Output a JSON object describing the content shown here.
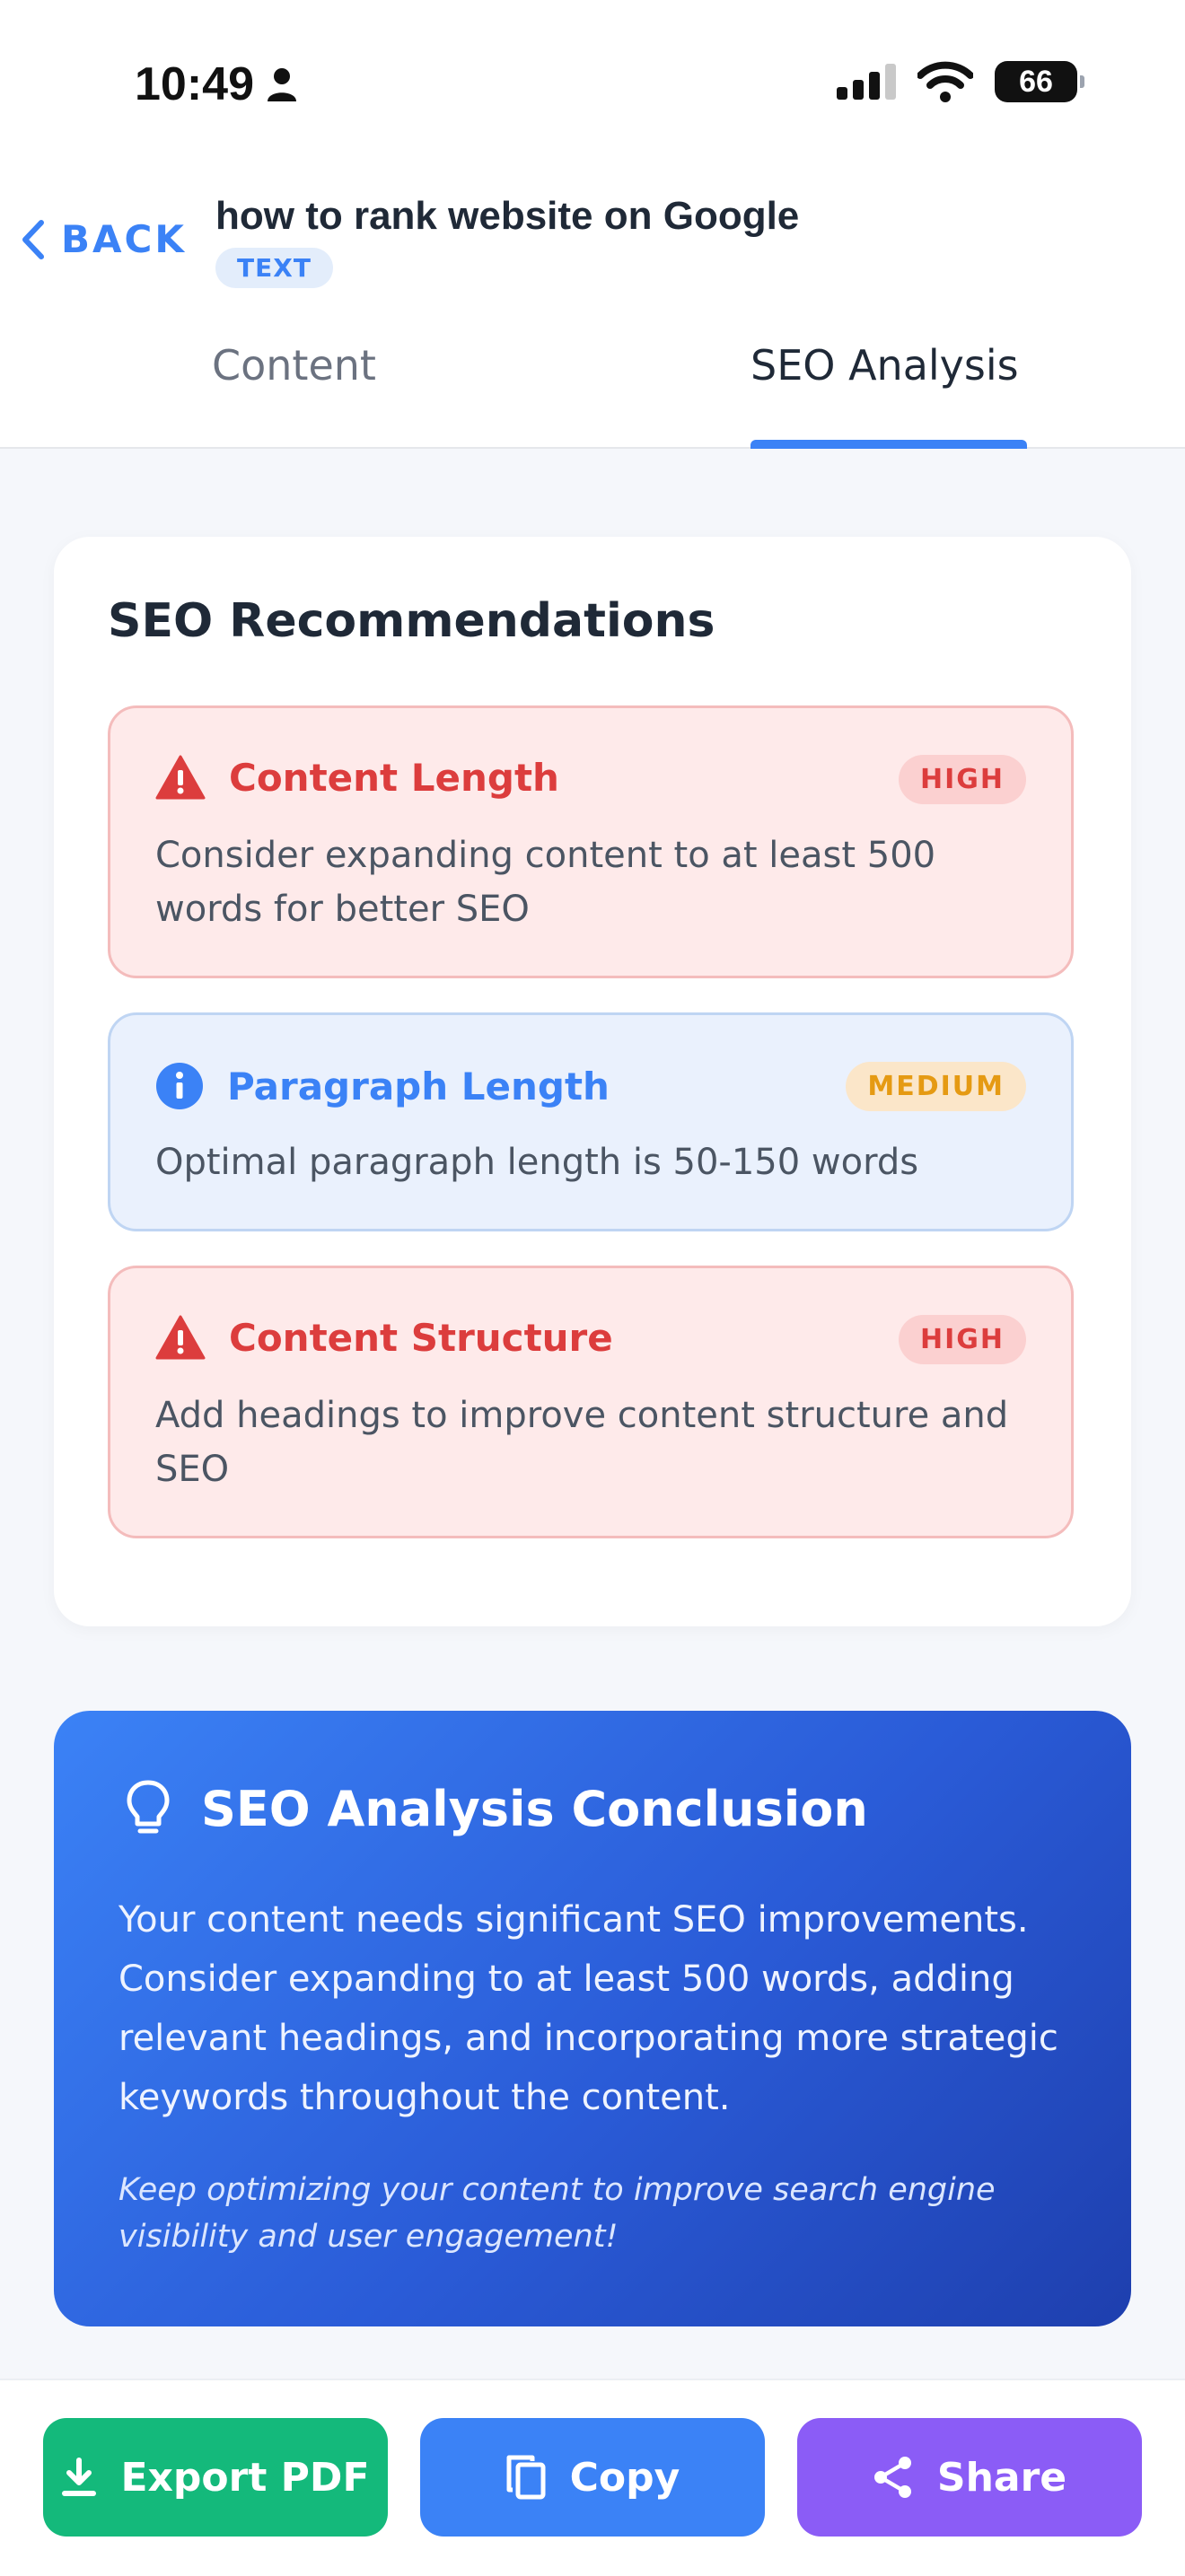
{
  "status": {
    "time": "10:49",
    "battery": "66"
  },
  "header": {
    "back_label": "BACK",
    "title": "how to rank website on Google",
    "type_badge": "TEXT"
  },
  "tabs": [
    {
      "label": "Content"
    },
    {
      "label": "SEO Analysis",
      "active": true
    }
  ],
  "recommendations": {
    "title": "SEO Recommendations",
    "items": [
      {
        "icon": "warning-icon",
        "label": "Content Length",
        "priority": "HIGH",
        "description": "Consider expanding content to at least 500 words for better SEO"
      },
      {
        "icon": "info-icon",
        "label": "Paragraph Length",
        "priority": "MEDIUM",
        "description": "Optimal paragraph length is 50-150 words"
      },
      {
        "icon": "warning-icon",
        "label": "Content Structure",
        "priority": "HIGH",
        "description": "Add headings to improve content structure and SEO"
      }
    ]
  },
  "conclusion": {
    "icon": "lightbulb-icon",
    "title": "SEO Analysis Conclusion",
    "body": "Your content needs significant SEO improvements. Consider expanding to at least 500 words, adding relevant headings, and incorporating more strategic keywords throughout the content.",
    "note": "Keep optimizing your content to improve search engine visibility and user engagement!"
  },
  "actions": {
    "export_label": "Export PDF",
    "copy_label": "Copy",
    "share_label": "Share"
  },
  "colors": {
    "accent": "#3b82f6",
    "high": "#dc3d3d",
    "medium": "#e59a13",
    "export": "#14b97b",
    "share": "#8b5cf6"
  }
}
